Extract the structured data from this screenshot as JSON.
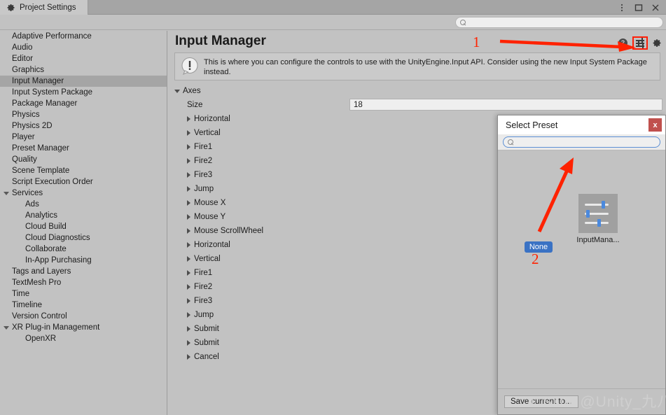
{
  "window": {
    "tab_label": "Project Settings",
    "tab_icon": "gear-icon",
    "controls": [
      {
        "name": "window-menu-button",
        "glyph": "⋮"
      },
      {
        "name": "window-maximize-button",
        "glyph": "□"
      },
      {
        "name": "window-close-button",
        "glyph": "✕"
      }
    ]
  },
  "search": {
    "value": "",
    "placeholder": "",
    "icon": "search-icon"
  },
  "sidebar": {
    "items": [
      {
        "label": "Adaptive Performance",
        "level": 0,
        "expandable": false,
        "selected": false
      },
      {
        "label": "Audio",
        "level": 0,
        "expandable": false,
        "selected": false
      },
      {
        "label": "Editor",
        "level": 0,
        "expandable": false,
        "selected": false
      },
      {
        "label": "Graphics",
        "level": 0,
        "expandable": false,
        "selected": false
      },
      {
        "label": "Input Manager",
        "level": 0,
        "expandable": false,
        "selected": true
      },
      {
        "label": "Input System Package",
        "level": 0,
        "expandable": false,
        "selected": false
      },
      {
        "label": "Package Manager",
        "level": 0,
        "expandable": false,
        "selected": false
      },
      {
        "label": "Physics",
        "level": 0,
        "expandable": false,
        "selected": false
      },
      {
        "label": "Physics 2D",
        "level": 0,
        "expandable": false,
        "selected": false
      },
      {
        "label": "Player",
        "level": 0,
        "expandable": false,
        "selected": false
      },
      {
        "label": "Preset Manager",
        "level": 0,
        "expandable": false,
        "selected": false
      },
      {
        "label": "Quality",
        "level": 0,
        "expandable": false,
        "selected": false
      },
      {
        "label": "Scene Template",
        "level": 0,
        "expandable": false,
        "selected": false
      },
      {
        "label": "Script Execution Order",
        "level": 0,
        "expandable": false,
        "selected": false
      },
      {
        "label": "Services",
        "level": 0,
        "expandable": true,
        "selected": false
      },
      {
        "label": "Ads",
        "level": 1,
        "expandable": false,
        "selected": false
      },
      {
        "label": "Analytics",
        "level": 1,
        "expandable": false,
        "selected": false
      },
      {
        "label": "Cloud Build",
        "level": 1,
        "expandable": false,
        "selected": false
      },
      {
        "label": "Cloud Diagnostics",
        "level": 1,
        "expandable": false,
        "selected": false
      },
      {
        "label": "Collaborate",
        "level": 1,
        "expandable": false,
        "selected": false
      },
      {
        "label": "In-App Purchasing",
        "level": 1,
        "expandable": false,
        "selected": false
      },
      {
        "label": "Tags and Layers",
        "level": 0,
        "expandable": false,
        "selected": false
      },
      {
        "label": "TextMesh Pro",
        "level": 0,
        "expandable": false,
        "selected": false
      },
      {
        "label": "Time",
        "level": 0,
        "expandable": false,
        "selected": false
      },
      {
        "label": "Timeline",
        "level": 0,
        "expandable": false,
        "selected": false
      },
      {
        "label": "Version Control",
        "level": 0,
        "expandable": false,
        "selected": false
      },
      {
        "label": "XR Plug-in Management",
        "level": 0,
        "expandable": true,
        "selected": false
      },
      {
        "label": "OpenXR",
        "level": 1,
        "expandable": false,
        "selected": false
      }
    ]
  },
  "main": {
    "title": "Input Manager",
    "header_icons": [
      {
        "name": "help-icon",
        "label": "?"
      },
      {
        "name": "preset-icon",
        "label": ""
      },
      {
        "name": "settings-gear-icon",
        "label": ""
      }
    ],
    "info": {
      "icon": "info-exclamation-icon",
      "text": "This is where you can configure the controls to use with the UnityEngine.Input API. Consider using the new Input System Package instead."
    },
    "axes": {
      "group_label": "Axes",
      "size_label": "Size",
      "size_value": "18",
      "entries": [
        "Horizontal",
        "Vertical",
        "Fire1",
        "Fire2",
        "Fire3",
        "Jump",
        "Mouse X",
        "Mouse Y",
        "Mouse ScrollWheel",
        "Horizontal",
        "Vertical",
        "Fire1",
        "Fire2",
        "Fire3",
        "Jump",
        "Submit",
        "Submit",
        "Cancel"
      ]
    }
  },
  "dialog": {
    "title": "Select Preset",
    "close_label": "x",
    "search": {
      "value": "",
      "placeholder": "",
      "icon": "search-icon"
    },
    "none_label": "None",
    "preset_label": "InputMana...",
    "preset_thumb_icon": "sliders-icon",
    "save_button_label": "Save current to..."
  },
  "annotations": [
    {
      "name": "annotation-1",
      "label": "1",
      "color": "#ff2200"
    },
    {
      "name": "annotation-2",
      "label": "2",
      "color": "#ff2200"
    }
  ],
  "watermark": {
    "text": "CSDN @Unity_九八"
  }
}
